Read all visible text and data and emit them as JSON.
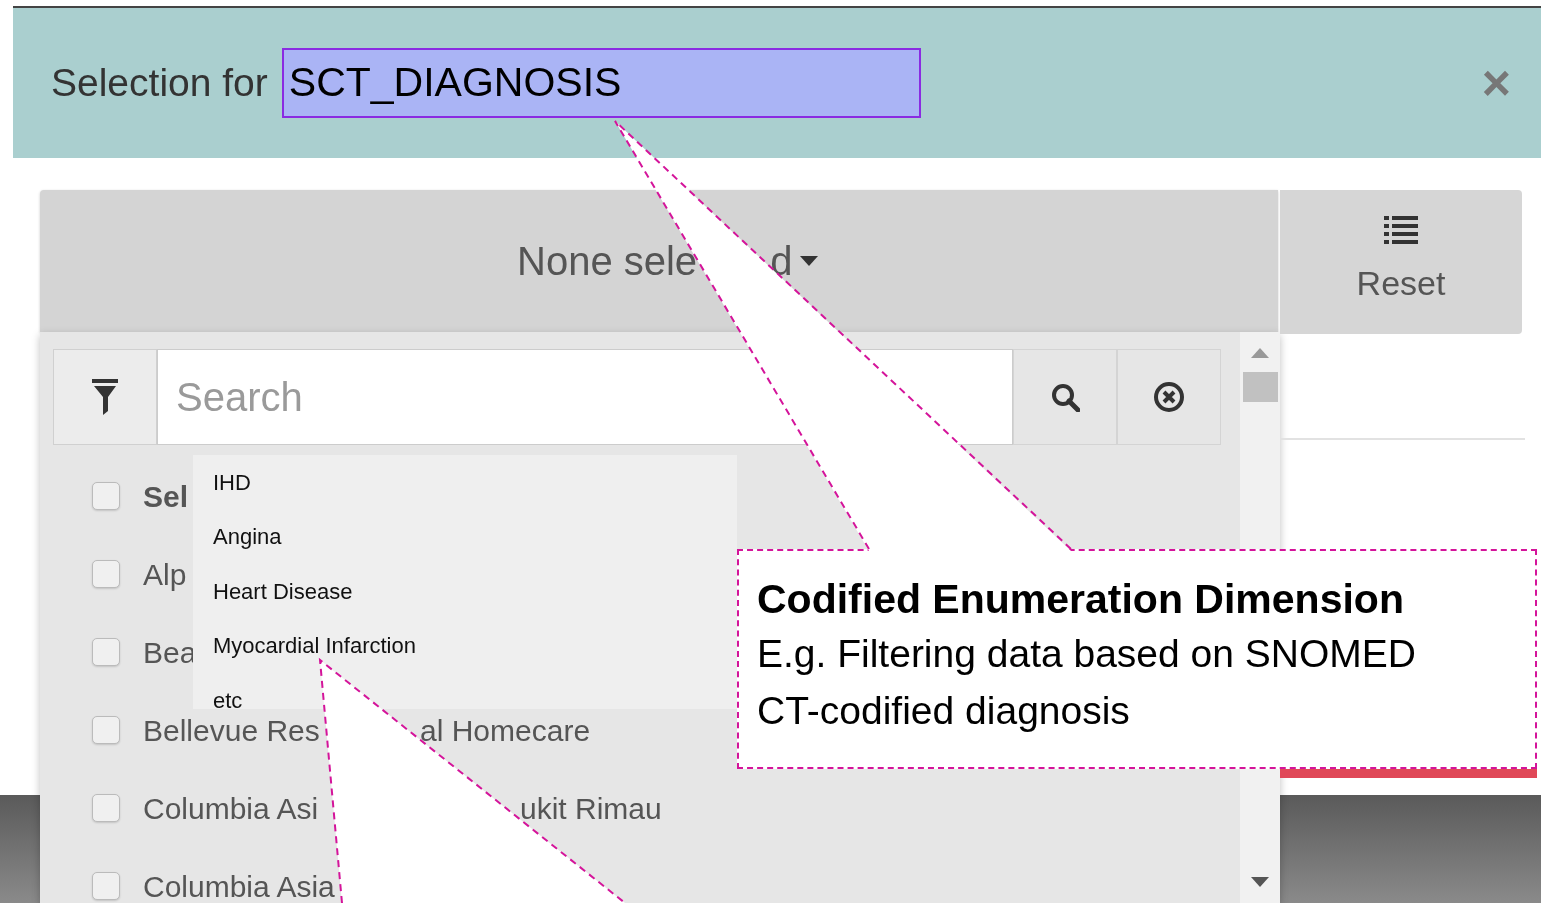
{
  "dialog": {
    "title_prefix": "Selection for",
    "field_label": "SCT_DIAGNOSIS",
    "close_glyph": "×"
  },
  "multiselect": {
    "button_text": "None sele",
    "button_text_tail": "d",
    "reset_label": "Reset",
    "search_placeholder": "Search",
    "items": [
      {
        "kind": "select-all",
        "label": "Sel",
        "checked": false
      },
      {
        "kind": "option",
        "label": "Alp",
        "checked": false
      },
      {
        "kind": "option",
        "label": "Bea",
        "checked": false
      },
      {
        "kind": "option",
        "label": "Bellevue Res",
        "tail": "al Homecare",
        "checked": false
      },
      {
        "kind": "option",
        "label": "Columbia Asi",
        "tail": "ukit Rimau",
        "checked": false
      },
      {
        "kind": "option",
        "label": "Columbia Asia",
        "checked": false
      }
    ]
  },
  "annotations": [
    {
      "kind": "value-list",
      "entries": [
        "IHD",
        "Angina",
        "Heart Disease",
        "Myocardial Infarction",
        "etc"
      ]
    },
    {
      "kind": "note",
      "title": "Codified Enumeration Dimension",
      "lines": [
        "E.g. Filtering data based on SNOMED",
        "CT-codified diagnosis"
      ]
    }
  ]
}
